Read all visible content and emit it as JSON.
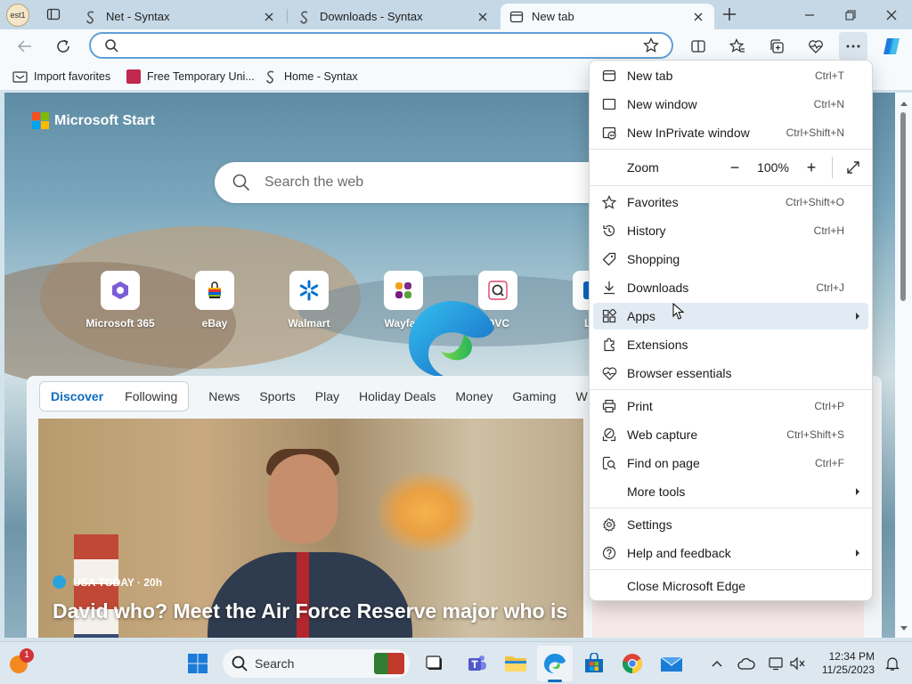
{
  "tabs": [
    {
      "label": "Net - Syntax"
    },
    {
      "label": "Downloads - Syntax"
    },
    {
      "label": "New tab"
    }
  ],
  "profile_label": "est1",
  "address": {
    "value": "",
    "placeholder": ""
  },
  "favorites": [
    {
      "label": "Import favorites"
    },
    {
      "label": "Free Temporary Uni..."
    },
    {
      "label": "Home - Syntax"
    }
  ],
  "ntp": {
    "logo_text": "Microsoft Start",
    "search_placeholder": "Search the web",
    "quick_links": [
      {
        "label": "Microsoft 365"
      },
      {
        "label": "eBay"
      },
      {
        "label": "Walmart"
      },
      {
        "label": "Wayfair"
      },
      {
        "label": "QVC"
      },
      {
        "label": "Lin"
      }
    ],
    "feed_tabs": {
      "active": "Discover",
      "following": "Following",
      "items": [
        "News",
        "Sports",
        "Play",
        "Holiday Deals",
        "Money",
        "Gaming",
        "W"
      ]
    },
    "story": {
      "source": "USA TODAY · 20h",
      "headline": "David who? Meet the Air Force Reserve major who is"
    }
  },
  "menu": {
    "items": [
      {
        "label": "New tab",
        "shortcut": "Ctrl+T"
      },
      {
        "label": "New window",
        "shortcut": "Ctrl+N"
      },
      {
        "label": "New InPrivate window",
        "shortcut": "Ctrl+Shift+N"
      }
    ],
    "zoom": {
      "label": "Zoom",
      "value": "100%",
      "minus": "−",
      "plus": "+"
    },
    "items2": [
      {
        "label": "Favorites",
        "shortcut": "Ctrl+Shift+O"
      },
      {
        "label": "History",
        "shortcut": "Ctrl+H"
      },
      {
        "label": "Shopping",
        "shortcut": ""
      },
      {
        "label": "Downloads",
        "shortcut": "Ctrl+J"
      },
      {
        "label": "Apps",
        "shortcut": ""
      },
      {
        "label": "Extensions",
        "shortcut": ""
      },
      {
        "label": "Browser essentials",
        "shortcut": ""
      }
    ],
    "items3": [
      {
        "label": "Print",
        "shortcut": "Ctrl+P"
      },
      {
        "label": "Web capture",
        "shortcut": "Ctrl+Shift+S"
      },
      {
        "label": "Find on page",
        "shortcut": "Ctrl+F"
      },
      {
        "label": "More tools",
        "shortcut": ""
      }
    ],
    "items4": [
      {
        "label": "Settings",
        "shortcut": ""
      },
      {
        "label": "Help and feedback",
        "shortcut": ""
      }
    ],
    "close_label": "Close Microsoft Edge"
  },
  "taskbar": {
    "search_label": "Search",
    "notification_count": "1",
    "time": "12:34 PM",
    "date": "11/25/2023"
  },
  "colors": {
    "accent": "#0f6cbd",
    "menu_highlight": "#e2ebf3",
    "address_border": "#5fa0d8"
  }
}
